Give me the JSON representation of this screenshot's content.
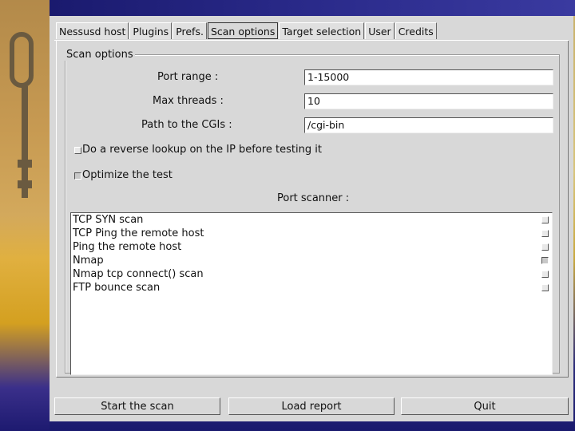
{
  "tabs": [
    "Nessusd host",
    "Plugins",
    "Prefs.",
    "Scan options",
    "Target selection",
    "User",
    "Credits"
  ],
  "active_tab": "Scan options",
  "scan_options": {
    "group_title": "Scan options",
    "port_range_label": "Port range :",
    "port_range_value": "1-15000",
    "max_threads_label": "Max threads :",
    "max_threads_value": "10",
    "cgi_path_label": "Path to the CGIs :",
    "cgi_path_value": "/cgi-bin",
    "reverse_lookup_label": "Do a reverse lookup on the IP before testing it",
    "reverse_lookup_checked": false,
    "optimize_label": "Optimize the test",
    "optimize_checked": true,
    "port_scanner_label": "Port scanner :"
  },
  "scanners": [
    {
      "label": "TCP SYN scan",
      "checked": false
    },
    {
      "label": "TCP Ping the remote host",
      "checked": false
    },
    {
      "label": "Ping the remote host",
      "checked": false
    },
    {
      "label": "Nmap",
      "checked": true
    },
    {
      "label": "Nmap tcp connect() scan",
      "checked": false
    },
    {
      "label": "FTP bounce scan",
      "checked": false
    }
  ],
  "buttons": {
    "start": "Start the scan",
    "load": "Load report",
    "quit": "Quit"
  }
}
